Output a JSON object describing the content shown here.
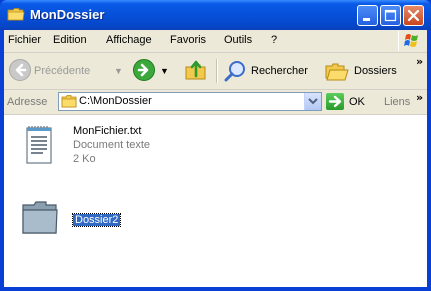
{
  "window": {
    "title": "MonDossier"
  },
  "menu": {
    "items": [
      "Fichier",
      "Edition",
      "Affichage",
      "Favoris",
      "Outils",
      "?"
    ]
  },
  "toolbar": {
    "back_label": "Précédente",
    "search_label": "Rechercher",
    "folders_label": "Dossiers"
  },
  "address": {
    "label": "Adresse",
    "value": "C:\\MonDossier",
    "go_label": "OK",
    "links_label": "Liens"
  },
  "items": [
    {
      "name": "MonFichier.txt",
      "type": "Document texte",
      "size": "2 Ko",
      "icon": "text-document-icon"
    },
    {
      "name": "Dossier2",
      "icon": "folder-icon",
      "selected": true
    }
  ],
  "colors": {
    "title_bar": "#0750d8",
    "selection": "#316ac5",
    "chrome": "#ece9d8"
  }
}
